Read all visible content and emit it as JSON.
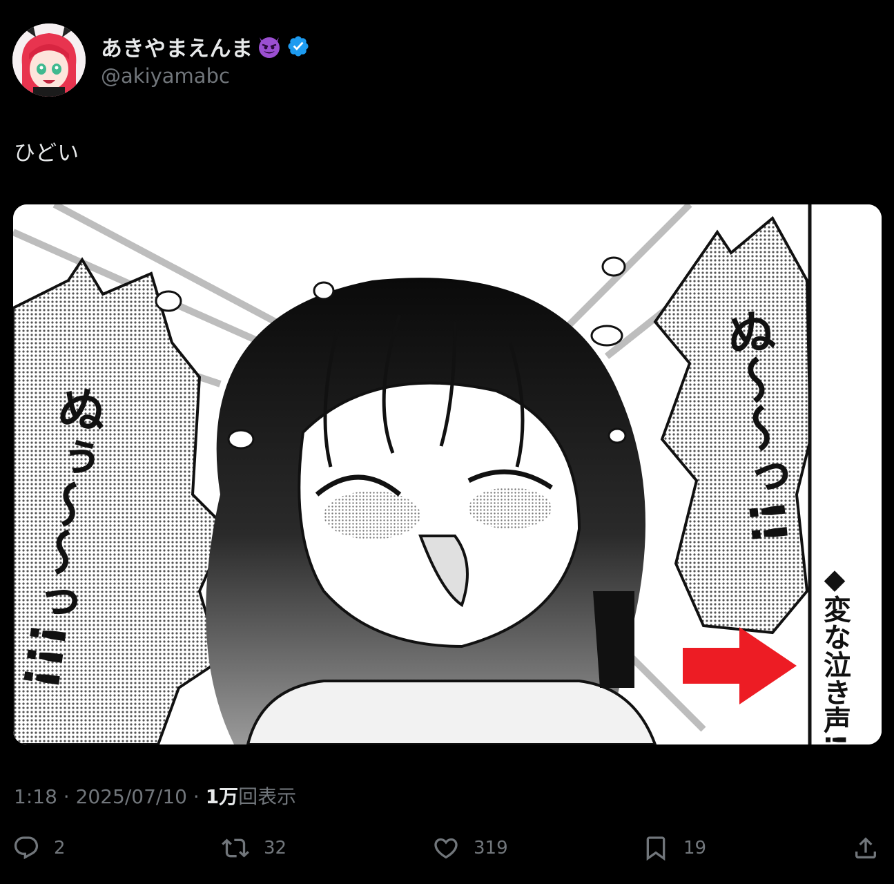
{
  "author": {
    "display_name": "あきやまえんま",
    "name_emoji": "smiling-imp-emoji",
    "verified_icon": "verified-badge-icon",
    "handle": "@akiyamabc"
  },
  "tweet": {
    "text": "ひどい"
  },
  "media": {
    "manga_left_sfx": "ぬぅ〜〜っ!!!",
    "manga_right_sfx": "ぬ〜〜っ!!",
    "manga_side_caption": "◆変な泣き声!!",
    "arrow_color": "#ed1c24"
  },
  "meta": {
    "time": "1:18",
    "sep1": " · ",
    "date": "2025/07/10",
    "sep2": " · ",
    "views_count": "1万",
    "views_label": "回表示"
  },
  "actions": {
    "reply_count": "2",
    "retweet_count": "32",
    "like_count": "319",
    "bookmark_count": "19"
  },
  "colors": {
    "background": "#000000",
    "text_primary": "#e7e9ea",
    "text_secondary": "#71767b",
    "verified": "#1d9bf0"
  }
}
